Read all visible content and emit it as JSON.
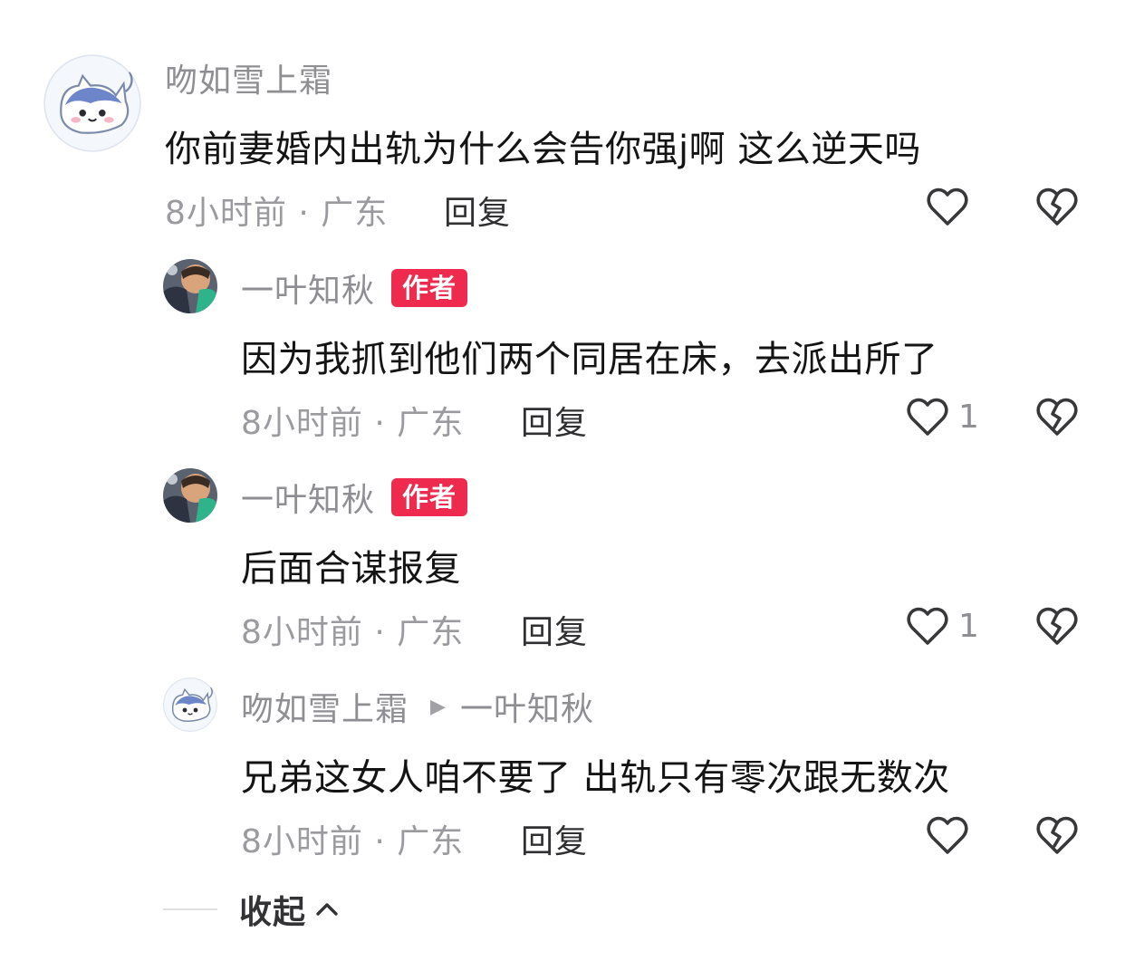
{
  "comments": [
    {
      "username": "吻如雪上霜",
      "content": "你前妻婚内出轨为什么会告你强j啊 这么逆天吗",
      "meta": "8小时前 · 广东",
      "reply_label": "回复",
      "likes": ""
    },
    {
      "username": "一叶知秋",
      "badge": "作者",
      "content": "因为我抓到他们两个同居在床，去派出所了",
      "meta": "8小时前 · 广东",
      "reply_label": "回复",
      "likes": "1"
    },
    {
      "username": "一叶知秋",
      "badge": "作者",
      "content": "后面合谋报复",
      "meta": "8小时前 · 广东",
      "reply_label": "回复",
      "likes": "1"
    },
    {
      "username": "吻如雪上霜",
      "reply_to": "一叶知秋",
      "content": "兄弟这女人咱不要了 出轨只有零次跟无数次",
      "meta": "8小时前 · 广东",
      "reply_label": "回复",
      "likes": ""
    }
  ],
  "collapse_label": "收起",
  "icons": {
    "like": "heart-outline-icon",
    "dislike": "broken-heart-icon",
    "collapse": "chevron-up-icon",
    "reply_to": "triangle-right-icon"
  },
  "colors": {
    "author_badge": "#ee2b4f",
    "username": "#8e8e93",
    "content": "#141414"
  }
}
